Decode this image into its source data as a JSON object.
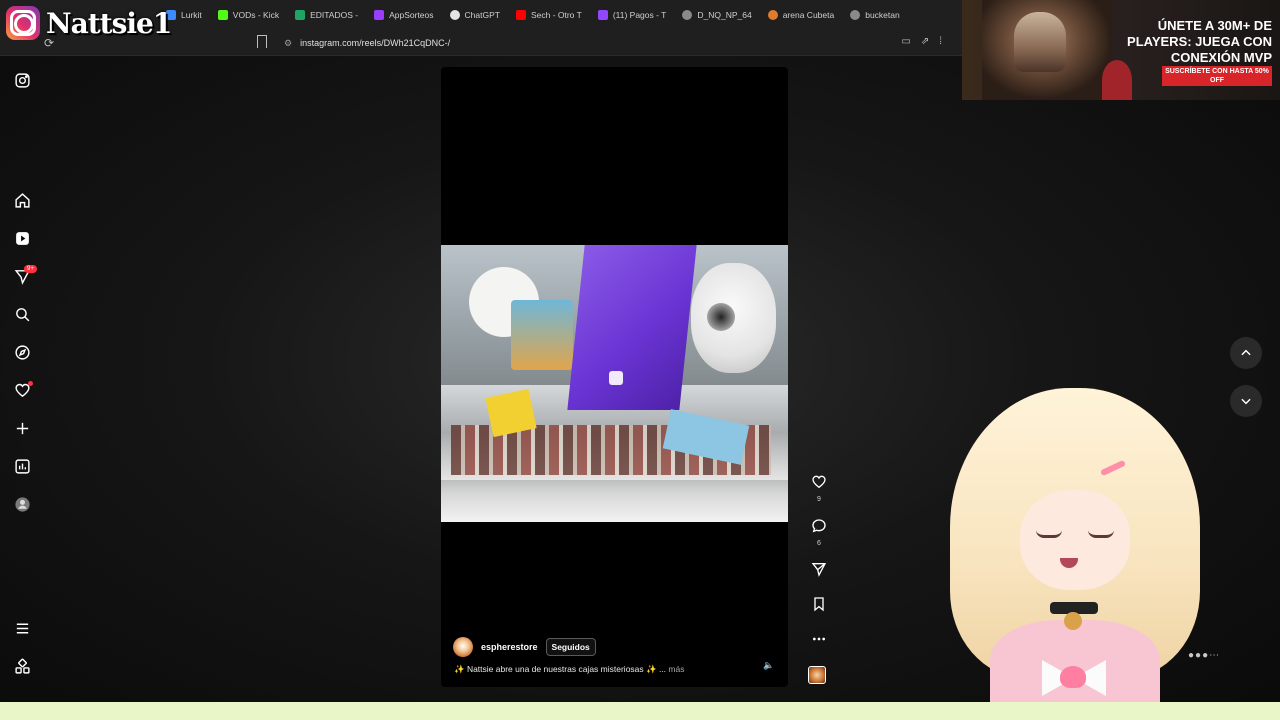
{
  "overlay": {
    "streamer_name": "Nattsie1"
  },
  "tabs": [
    {
      "label": "Lurkit",
      "icon_color": "#3d8bfd"
    },
    {
      "label": "VODs - Kick",
      "icon_color": "#53fc18"
    },
    {
      "label": "EDITADOS -",
      "icon_color": "#1fa463"
    },
    {
      "label": "AppSorteos",
      "icon_color": "#9b3dfd"
    },
    {
      "label": "ChatGPT",
      "icon_color": "#e5e5e5"
    },
    {
      "label": "Sech - Otro T",
      "icon_color": "#ff0000"
    },
    {
      "label": "(11) Pagos - T",
      "icon_color": "#9146ff"
    },
    {
      "label": "D_NQ_NP_64",
      "icon_color": "#8a8a8a"
    },
    {
      "label": "arena Cubeta",
      "icon_color": "#e07b2b"
    },
    {
      "label": "bucketan",
      "icon_color": "#8a8a8a"
    }
  ],
  "address_bar": {
    "url": "instagram.com/reels/DWh21CqDNC-/"
  },
  "ad": {
    "headline": "ÚNETE A 30M+ DE PLAYERS: JUEGA CON CONEXIÓN MVP",
    "cta": "SUSCRÍBETE CON HASTA 50% OFF"
  },
  "sidebar": {
    "notifications_badge": "9+",
    "items": [
      "instagram-logo",
      "home",
      "reels",
      "messages",
      "search",
      "explore",
      "notifications",
      "create",
      "dashboard",
      "profile",
      "menu",
      "also-from-meta"
    ]
  },
  "reel": {
    "username": "espherestore",
    "follow_label": "Seguidos",
    "caption": "✨ Nattsie abre una de nuestras cajas misteriosas ✨ ...",
    "more_label": "más"
  },
  "actions": {
    "likes": "9",
    "comments": "6"
  },
  "colors": {
    "accent_red": "#ff3040",
    "page_bg": "#0d0d0d",
    "bottom_strip": "#e9f7c8"
  }
}
